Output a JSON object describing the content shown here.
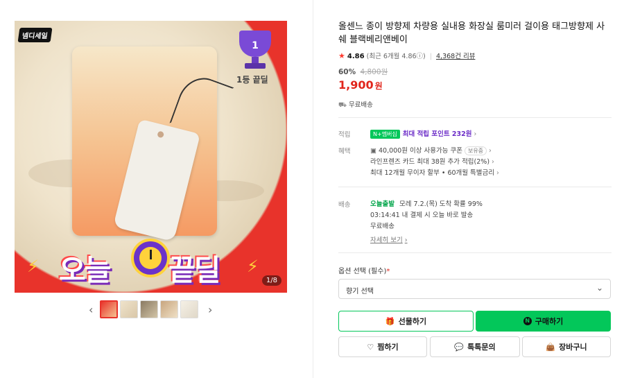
{
  "gallery": {
    "sale_badge": "넴디세일",
    "trophy_number": "1",
    "trophy_caption": "1등 끝딜",
    "banner_left": "오늘",
    "banner_right": "끝딜",
    "counter": "1/8",
    "prev_arrow": "‹",
    "next_arrow": "›",
    "thumbnail_count": 5
  },
  "product": {
    "title": "올센느 종이 방향제 차량용 실내용 화장실 룸미러 걸이용 태그방향제 사쉐 블랙베리앤베이",
    "rating": "4.86",
    "rating_recent": "(최근 6개월 4.86ⓘ)",
    "separator": "|",
    "reviews": "4,368건 리뷰",
    "discount_pct": "60%",
    "original_price": "4,800원",
    "price": "1,900",
    "price_unit": "원",
    "shipping": "무료배송"
  },
  "benefits": {
    "points_label": "적립",
    "points_badge": "N+멤버십",
    "points_text": "최대 적립 포인트 232원",
    "discount_label": "혜택",
    "coupon_text": "40,000원 이상 사용가능 쿠폰",
    "coupon_pill": "보유중",
    "card_text": "라인프렌즈 카드 최대 38원 추가 적립(2%)",
    "installment_text": "최대 12개월 무이자 할부 • 60개월 특별금리"
  },
  "delivery": {
    "label": "배송",
    "today": "오늘출발",
    "eta": "모레 7.2.(목) 도착 확률 99%",
    "cutoff": "03:14:41 내 결제 시 오늘 바로 발송",
    "fee": "무료배송",
    "details_link": "자세히 보기"
  },
  "options": {
    "label": "옵션 선택 (필수)",
    "required_mark": "*",
    "selected": "향기 선택"
  },
  "buttons": {
    "gift": "선물하기",
    "buy": "구매하기",
    "wish": "찜하기",
    "talk": "톡톡문의",
    "cart": "장바구니"
  },
  "colors": {
    "accent_green": "#03c75a",
    "price_red": "#e1251b",
    "hero_red": "#e8332b"
  }
}
